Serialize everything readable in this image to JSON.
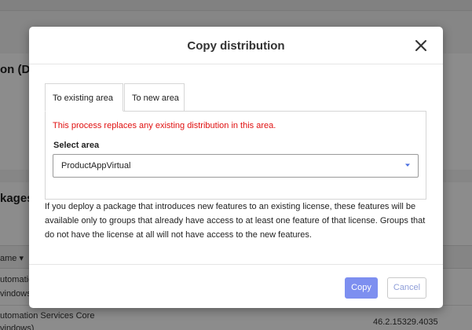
{
  "background": {
    "page_title": "on (De",
    "section_title": "kages",
    "column_header": "ame",
    "rows": [
      {
        "line1": "utomation",
        "line2": "vindows)"
      },
      {
        "line1": "utomation Services Core",
        "line2": "vindows)",
        "version": "46.2.15329.4035"
      }
    ]
  },
  "dialog": {
    "title": "Copy distribution",
    "close_icon": "close-icon",
    "tabs": [
      {
        "label": "To existing area",
        "active": true
      },
      {
        "label": "To new area",
        "active": false
      }
    ],
    "warning": "This process replaces any existing distribution in this area.",
    "select_label": "Select area",
    "select_value": "ProductAppVirtual",
    "info": "If you deploy a package that introduces new features to an existing license, these features will be available only to groups that already have access to at least one feature of that license. Groups that do not have the license at all will not have access to the new features.",
    "buttons": {
      "copy": "Copy",
      "cancel": "Cancel"
    }
  },
  "colors": {
    "primary_button": "#7d8ff0",
    "warning_text": "#e01010",
    "select_caret": "#4a6ee0"
  }
}
